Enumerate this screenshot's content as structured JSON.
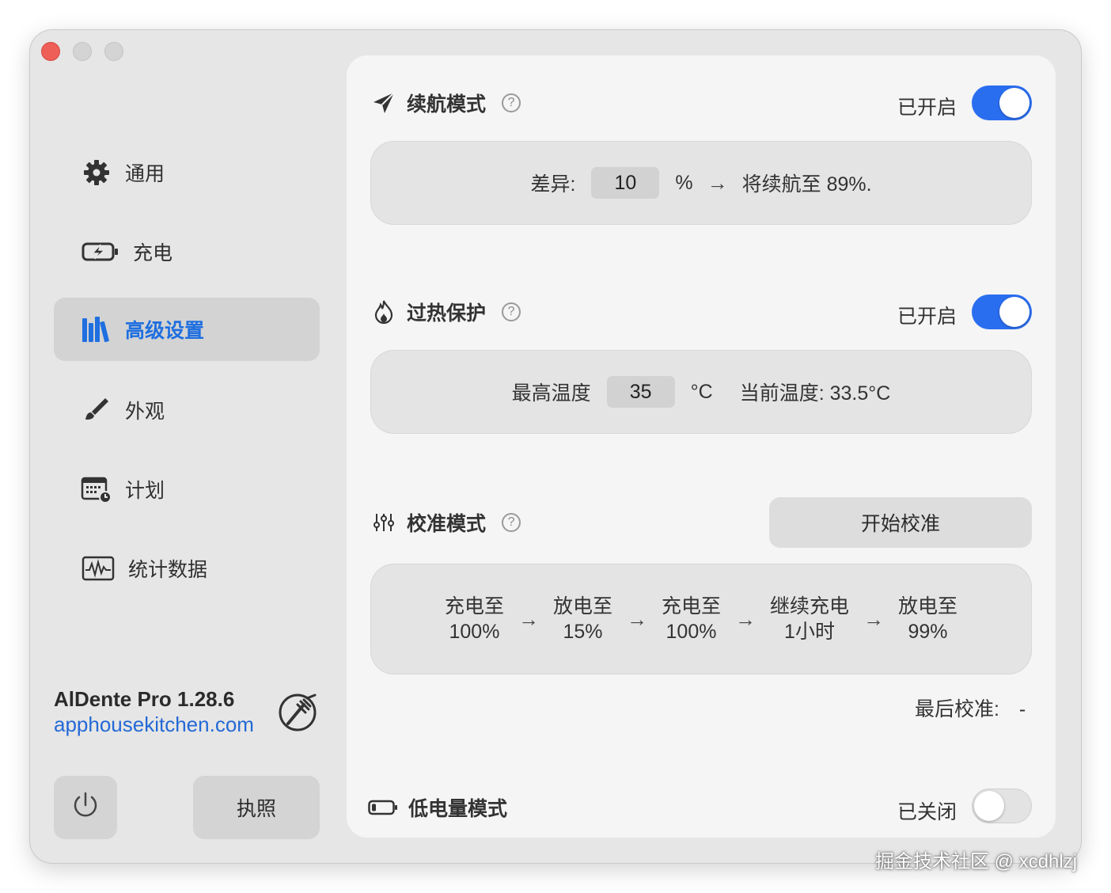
{
  "sidebar": {
    "items": [
      {
        "label": "通用",
        "icon": "gear-icon"
      },
      {
        "label": "充电",
        "icon": "battery-charging-icon"
      },
      {
        "label": "高级设置",
        "icon": "books-icon"
      },
      {
        "label": "外观",
        "icon": "paintbrush-icon"
      },
      {
        "label": "计划",
        "icon": "calendar-clock-icon"
      },
      {
        "label": "统计数据",
        "icon": "waveform-icon"
      }
    ],
    "active_index": 2,
    "app_name": "AlDente Pro 1.28.6",
    "app_link": "apphousekitchen.com",
    "license_label": "执照"
  },
  "sailing": {
    "title": "续航模式",
    "status": "已开启",
    "enabled": true,
    "diff_label": "差异:",
    "diff_value": "10",
    "unit": "%",
    "result": "将续航至 89%."
  },
  "heat": {
    "title": "过热保护",
    "status": "已开启",
    "enabled": true,
    "max_label": "最高温度",
    "max_value": "35",
    "unit": "°C",
    "current": "当前温度: 33.5°C"
  },
  "calibration": {
    "title": "校准模式",
    "start_label": "开始校准",
    "steps": [
      {
        "line1": "充电至",
        "line2": "100%"
      },
      {
        "line1": "放电至",
        "line2": "15%"
      },
      {
        "line1": "充电至",
        "line2": "100%"
      },
      {
        "line1": "继续充电",
        "line2": "1小时"
      },
      {
        "line1": "放电至",
        "line2": "99%"
      }
    ],
    "last_label": "最后校准:",
    "last_value": "-"
  },
  "low_power": {
    "title": "低电量模式",
    "status": "已关闭",
    "enabled": false
  },
  "watermark": "掘金技术社区 @ xcdhlzj",
  "colors": {
    "accent": "#2a6ef0",
    "link": "#2469d6",
    "active_nav_text": "#1f6fe0",
    "close_button": "#ee5f57"
  }
}
